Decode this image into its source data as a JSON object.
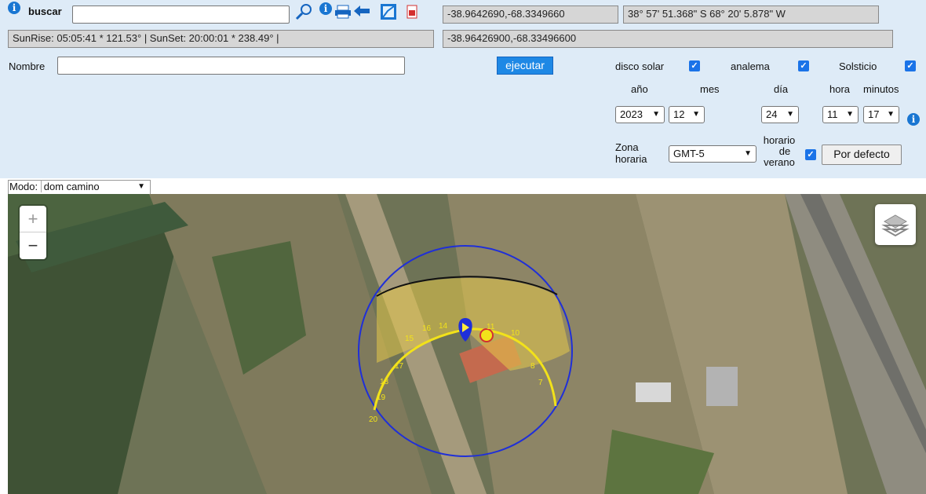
{
  "search": {
    "label": "buscar",
    "value": ""
  },
  "coords": {
    "decimal": "-38.9642690,-68.3349660",
    "dms": "38° 57' 51.368\" S    68° 20' 5.878\" W",
    "decimal_full": "-38.96426900,-68.33496600"
  },
  "sun_info": "SunRise: 05:05:41 * 121.53° | SunSet: 20:00:01 * 238.49° |",
  "nombre": {
    "label": "Nombre",
    "value": ""
  },
  "ejecutar_label": "ejecutar",
  "options": {
    "disco_solar": "disco solar",
    "analema": "analema",
    "solsticio": "Solsticio"
  },
  "date_headers": {
    "year": "año",
    "month": "mes",
    "day": "día",
    "hour": "hora",
    "minutes": "minutos"
  },
  "date_values": {
    "year": "2023",
    "month": "12",
    "day": "24",
    "hour": "11",
    "minutes": "17"
  },
  "zona": {
    "label_line1": "Zona",
    "label_line2": "horaria",
    "value": "GMT-5"
  },
  "verano": {
    "line1": "horario",
    "line2": "de",
    "line3": "verano"
  },
  "por_defecto_label": "Por defecto",
  "modo": {
    "label": "Modo:",
    "value": "dom camino"
  },
  "map": {
    "zoom_in": "+",
    "zoom_out": "−",
    "sun_hours": [
      "7",
      "8",
      "9",
      "10",
      "11",
      "12",
      "13",
      "14",
      "15",
      "16",
      "17",
      "18",
      "19",
      "20"
    ]
  },
  "colors": {
    "circle": "#1f2fd8",
    "sun_path": "#f2e21a",
    "shade": "#e6c84a",
    "panel_bg": "#deebf7"
  }
}
